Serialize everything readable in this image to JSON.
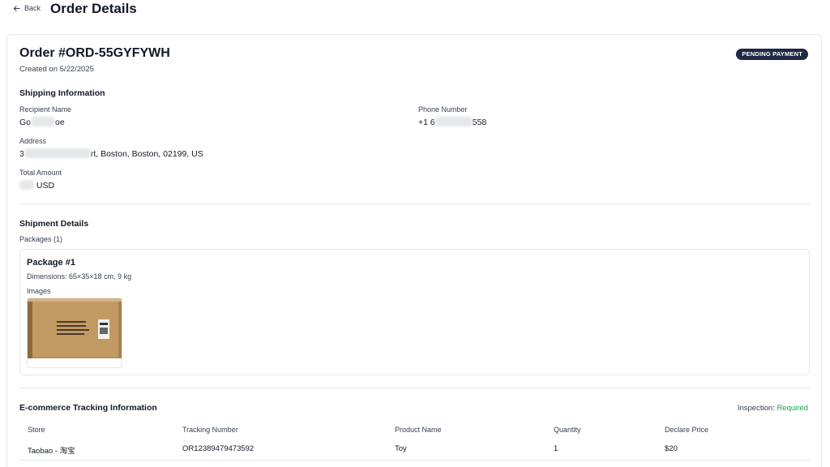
{
  "header": {
    "back_label": "Back",
    "title": "Order Details"
  },
  "order": {
    "id_label": "Order #ORD-55GYFYWH",
    "created_text": "Created on 5/22/2025",
    "status": "PENDING PAYMENT"
  },
  "shipping": {
    "section_title": "Shipping Information",
    "recipient_label": "Recipient Name",
    "recipient_prefix": "Go",
    "recipient_suffix": "oe",
    "phone_label": "Phone Number",
    "phone_prefix": "+1 6",
    "phone_suffix": "558",
    "address_label": "Address",
    "address_prefix": "3",
    "address_suffix": "rt, Boston, Boston, 02199, US",
    "total_label": "Total Amount",
    "total_suffix": "USD"
  },
  "shipment": {
    "section_title": "Shipment Details",
    "packages_label": "Packages (1)",
    "package": {
      "title": "Package #1",
      "dimensions": "Dimensions: 65×35×18 cm, 9 kg",
      "images_label": "Images"
    }
  },
  "tracking": {
    "section_title": "E-commerce Tracking Information",
    "inspection_label": "Inspection:",
    "inspection_value": "Required",
    "columns": [
      "Store",
      "Tracking Number",
      "Product Name",
      "Quantity",
      "Declare Price"
    ],
    "rows": [
      {
        "store": "Taobao - 淘宝",
        "tracking_number": "OR12389479473592",
        "product": "Toy",
        "quantity": "1",
        "price": "$20"
      }
    ]
  },
  "colors": {
    "badge_bg": "#1f2a44",
    "required_green": "#16a34a",
    "border": "#e5e7eb"
  }
}
